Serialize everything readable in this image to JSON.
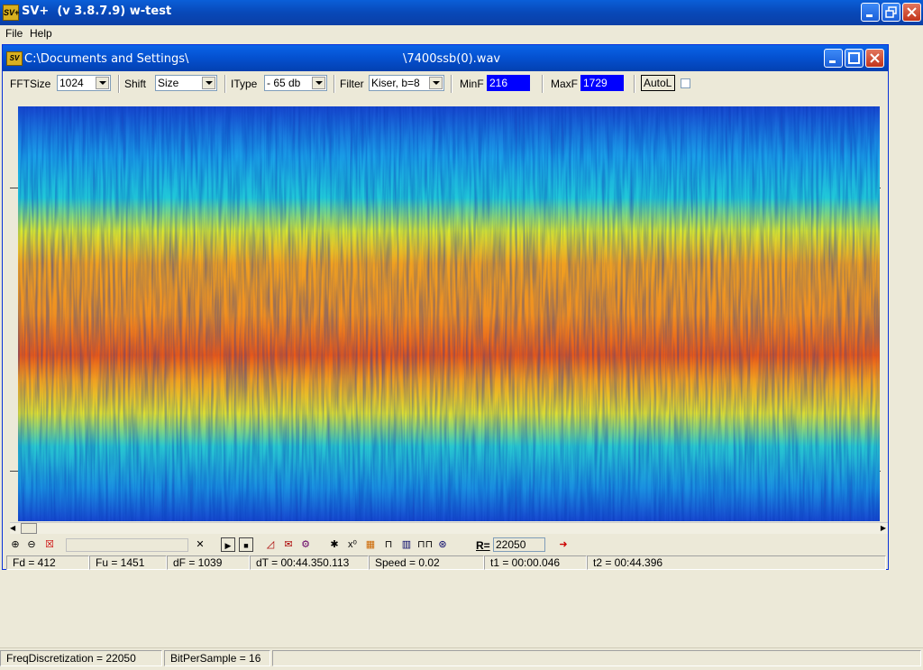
{
  "app": {
    "icon_text": "SV+",
    "title": "SV+  (v 3.8.7.9) w-test"
  },
  "menu": {
    "file": "File",
    "help": "Help"
  },
  "child_window": {
    "icon_text": "SV",
    "title_path": "C:\\Documents and Settings\\",
    "title_file": "\\7400ssb(0).wav"
  },
  "toolbar": {
    "fftsize_label": "FFTSize",
    "fftsize_value": "1024",
    "shift_label": "Shift",
    "shift_value": "Size",
    "itype_label": "IType",
    "itype_value": "- 65 db",
    "filter_label": "Filter",
    "filter_value": "Kiser, b=8",
    "minf_label": "MinF",
    "minf_value": "216",
    "maxf_label": "MaxF",
    "maxf_value": "1729",
    "autol_label": "AutoL"
  },
  "icon_toolbar": {
    "r_label": "R=",
    "r_value": "22050"
  },
  "status": {
    "fd": "Fd = 412",
    "fu": "Fu = 1451",
    "df": "dF = 1039",
    "dt": "dT = 00:44.350.113",
    "speed": "Speed = 0.02",
    "t1": "t1 = 00:00.046",
    "t2": "t2 = 00:44.396"
  },
  "bottom_status": {
    "freq": "FreqDiscretization = 22050",
    "bits": "BitPerSample = 16"
  },
  "colors": {
    "titlebar": "#0848b8",
    "minf_maxf_bg": "#0000ff",
    "spectrogram_low": "#1f4fd8",
    "spectrogram_high": "#e84010"
  }
}
